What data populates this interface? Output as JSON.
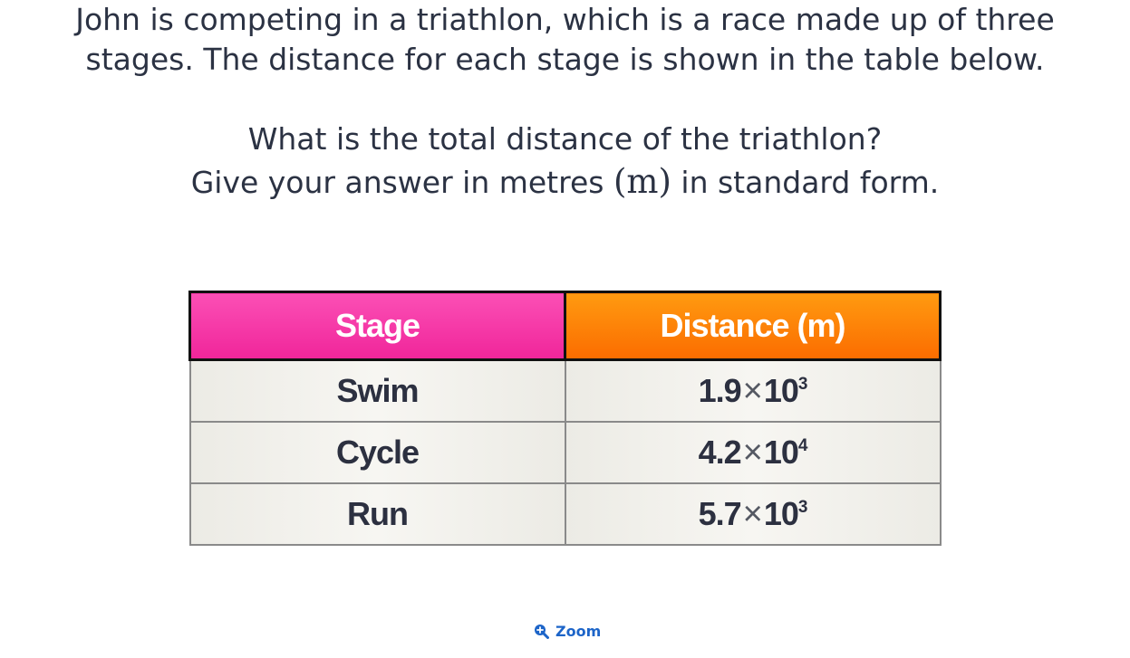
{
  "question": {
    "intro_line1": "John is competing in a triathlon, which is a race made up of three",
    "intro_line2": "stages. The distance for each stage is shown in the table below.",
    "ask_line1": "What is the total distance of the triathlon?",
    "ask_line2_before": "Give your answer in metres ",
    "ask_line2_unit": "(m)",
    "ask_line2_after": " in standard form."
  },
  "table": {
    "headers": [
      "Stage",
      "Distance (m)"
    ],
    "rows": [
      {
        "stage": "Swim",
        "mantissa": "1.9",
        "times": "×",
        "base": "10",
        "exponent": "3"
      },
      {
        "stage": "Cycle",
        "mantissa": "4.2",
        "times": "×",
        "base": "10",
        "exponent": "4"
      },
      {
        "stage": "Run",
        "mantissa": "5.7",
        "times": "×",
        "base": "10",
        "exponent": "3"
      }
    ],
    "colors": {
      "stage_header": "#f0259a",
      "distance_header": "#fb6c00"
    }
  },
  "zoom": {
    "label": "Zoom",
    "icon": "zoom-in-icon",
    "color": "#1c64c8"
  }
}
